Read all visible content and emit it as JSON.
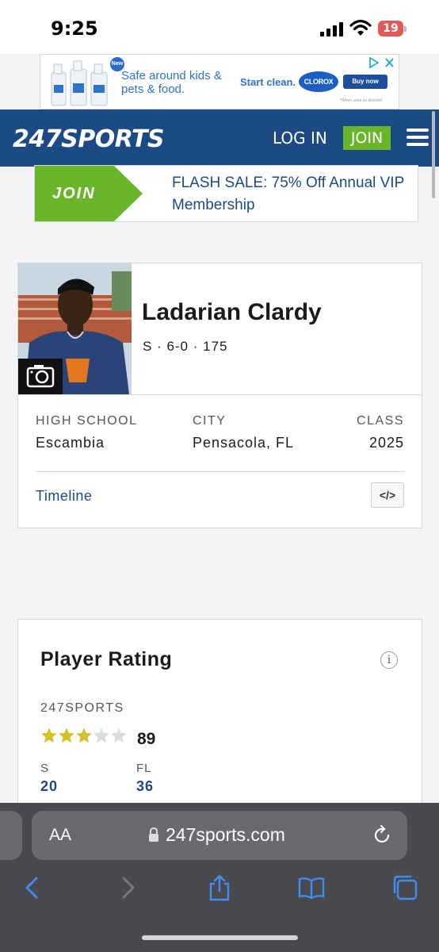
{
  "status_bar": {
    "time": "9:25",
    "battery": "19"
  },
  "ad": {
    "badge": "New",
    "copy": "Safe around kids & pets & food.",
    "cta_text": "Start clean.",
    "brand": "CLOROX",
    "buy_label": "Buy now",
    "fine_print": "*When used as directed"
  },
  "header": {
    "logo": "247SPORTS",
    "login_label": "LOG IN",
    "join_label": "JOIN"
  },
  "flash_banner": {
    "join_label": "JOIN",
    "text": "FLASH SALE: 75% Off Annual VIP Membership"
  },
  "player": {
    "name": "Ladarian Clardy",
    "meta": "S · 6-0 · 175",
    "info": [
      {
        "label": "HIGH SCHOOL",
        "value": "Escambia"
      },
      {
        "label": "CITY",
        "value": "Pensacola, FL"
      },
      {
        "label": "CLASS",
        "value": "2025"
      }
    ],
    "timeline_label": "Timeline",
    "embed_label": "</>"
  },
  "rating": {
    "title": "Player Rating",
    "source": "247SPORTS",
    "stars": 3,
    "max_stars": 5,
    "score": "89",
    "ranks": [
      {
        "label": "S",
        "value": "20"
      },
      {
        "label": "FL",
        "value": "36"
      }
    ]
  },
  "browser": {
    "text_size_label": "AA",
    "url": "247sports.com"
  },
  "colors": {
    "brand_blue": "#1c4a84",
    "join_green": "#69b62a",
    "star_gold": "#d4c02a",
    "star_empty": "#dcdcdc"
  }
}
